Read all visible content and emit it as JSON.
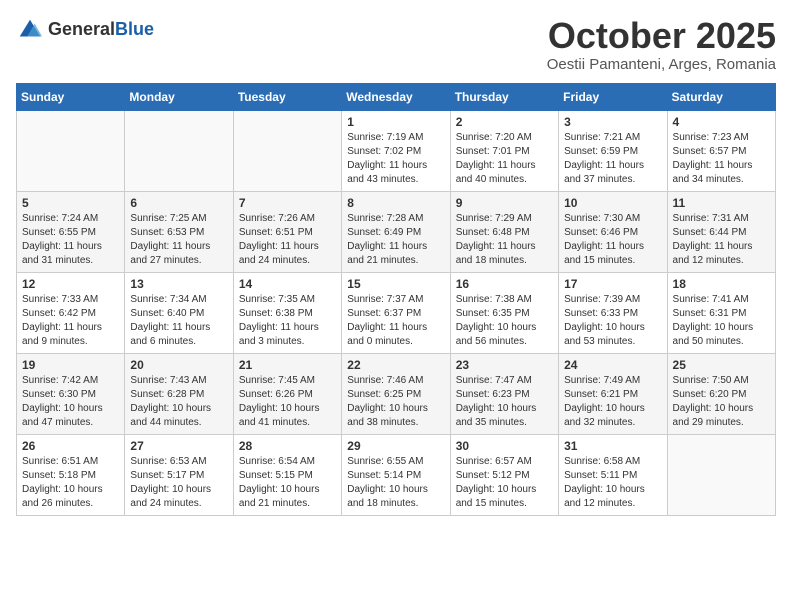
{
  "header": {
    "logo_general": "General",
    "logo_blue": "Blue",
    "month": "October 2025",
    "location": "Oestii Pamanteni, Arges, Romania"
  },
  "days_of_week": [
    "Sunday",
    "Monday",
    "Tuesday",
    "Wednesday",
    "Thursday",
    "Friday",
    "Saturday"
  ],
  "weeks": [
    [
      {
        "day": "",
        "info": ""
      },
      {
        "day": "",
        "info": ""
      },
      {
        "day": "",
        "info": ""
      },
      {
        "day": "1",
        "info": "Sunrise: 7:19 AM\nSunset: 7:02 PM\nDaylight: 11 hours\nand 43 minutes."
      },
      {
        "day": "2",
        "info": "Sunrise: 7:20 AM\nSunset: 7:01 PM\nDaylight: 11 hours\nand 40 minutes."
      },
      {
        "day": "3",
        "info": "Sunrise: 7:21 AM\nSunset: 6:59 PM\nDaylight: 11 hours\nand 37 minutes."
      },
      {
        "day": "4",
        "info": "Sunrise: 7:23 AM\nSunset: 6:57 PM\nDaylight: 11 hours\nand 34 minutes."
      }
    ],
    [
      {
        "day": "5",
        "info": "Sunrise: 7:24 AM\nSunset: 6:55 PM\nDaylight: 11 hours\nand 31 minutes."
      },
      {
        "day": "6",
        "info": "Sunrise: 7:25 AM\nSunset: 6:53 PM\nDaylight: 11 hours\nand 27 minutes."
      },
      {
        "day": "7",
        "info": "Sunrise: 7:26 AM\nSunset: 6:51 PM\nDaylight: 11 hours\nand 24 minutes."
      },
      {
        "day": "8",
        "info": "Sunrise: 7:28 AM\nSunset: 6:49 PM\nDaylight: 11 hours\nand 21 minutes."
      },
      {
        "day": "9",
        "info": "Sunrise: 7:29 AM\nSunset: 6:48 PM\nDaylight: 11 hours\nand 18 minutes."
      },
      {
        "day": "10",
        "info": "Sunrise: 7:30 AM\nSunset: 6:46 PM\nDaylight: 11 hours\nand 15 minutes."
      },
      {
        "day": "11",
        "info": "Sunrise: 7:31 AM\nSunset: 6:44 PM\nDaylight: 11 hours\nand 12 minutes."
      }
    ],
    [
      {
        "day": "12",
        "info": "Sunrise: 7:33 AM\nSunset: 6:42 PM\nDaylight: 11 hours\nand 9 minutes."
      },
      {
        "day": "13",
        "info": "Sunrise: 7:34 AM\nSunset: 6:40 PM\nDaylight: 11 hours\nand 6 minutes."
      },
      {
        "day": "14",
        "info": "Sunrise: 7:35 AM\nSunset: 6:38 PM\nDaylight: 11 hours\nand 3 minutes."
      },
      {
        "day": "15",
        "info": "Sunrise: 7:37 AM\nSunset: 6:37 PM\nDaylight: 11 hours\nand 0 minutes."
      },
      {
        "day": "16",
        "info": "Sunrise: 7:38 AM\nSunset: 6:35 PM\nDaylight: 10 hours\nand 56 minutes."
      },
      {
        "day": "17",
        "info": "Sunrise: 7:39 AM\nSunset: 6:33 PM\nDaylight: 10 hours\nand 53 minutes."
      },
      {
        "day": "18",
        "info": "Sunrise: 7:41 AM\nSunset: 6:31 PM\nDaylight: 10 hours\nand 50 minutes."
      }
    ],
    [
      {
        "day": "19",
        "info": "Sunrise: 7:42 AM\nSunset: 6:30 PM\nDaylight: 10 hours\nand 47 minutes."
      },
      {
        "day": "20",
        "info": "Sunrise: 7:43 AM\nSunset: 6:28 PM\nDaylight: 10 hours\nand 44 minutes."
      },
      {
        "day": "21",
        "info": "Sunrise: 7:45 AM\nSunset: 6:26 PM\nDaylight: 10 hours\nand 41 minutes."
      },
      {
        "day": "22",
        "info": "Sunrise: 7:46 AM\nSunset: 6:25 PM\nDaylight: 10 hours\nand 38 minutes."
      },
      {
        "day": "23",
        "info": "Sunrise: 7:47 AM\nSunset: 6:23 PM\nDaylight: 10 hours\nand 35 minutes."
      },
      {
        "day": "24",
        "info": "Sunrise: 7:49 AM\nSunset: 6:21 PM\nDaylight: 10 hours\nand 32 minutes."
      },
      {
        "day": "25",
        "info": "Sunrise: 7:50 AM\nSunset: 6:20 PM\nDaylight: 10 hours\nand 29 minutes."
      }
    ],
    [
      {
        "day": "26",
        "info": "Sunrise: 6:51 AM\nSunset: 5:18 PM\nDaylight: 10 hours\nand 26 minutes."
      },
      {
        "day": "27",
        "info": "Sunrise: 6:53 AM\nSunset: 5:17 PM\nDaylight: 10 hours\nand 24 minutes."
      },
      {
        "day": "28",
        "info": "Sunrise: 6:54 AM\nSunset: 5:15 PM\nDaylight: 10 hours\nand 21 minutes."
      },
      {
        "day": "29",
        "info": "Sunrise: 6:55 AM\nSunset: 5:14 PM\nDaylight: 10 hours\nand 18 minutes."
      },
      {
        "day": "30",
        "info": "Sunrise: 6:57 AM\nSunset: 5:12 PM\nDaylight: 10 hours\nand 15 minutes."
      },
      {
        "day": "31",
        "info": "Sunrise: 6:58 AM\nSunset: 5:11 PM\nDaylight: 10 hours\nand 12 minutes."
      },
      {
        "day": "",
        "info": ""
      }
    ]
  ]
}
